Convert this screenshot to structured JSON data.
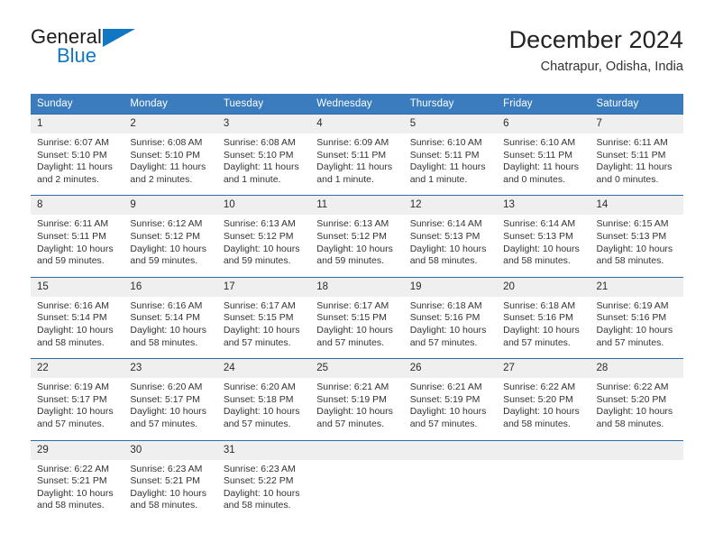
{
  "logo": {
    "text_primary": "General",
    "text_secondary": "Blue",
    "primary_color": "#1b1b1b",
    "accent_color": "#1277c2"
  },
  "header": {
    "title": "December 2024",
    "subtitle": "Chatrapur, Odisha, India"
  },
  "theme": {
    "header_row_bg": "#3a7cbe",
    "header_row_text": "#ffffff",
    "daynum_bg": "#efefef",
    "grid_line": "#2f6ca8",
    "body_text": "#333333"
  },
  "calendar": {
    "weekday_headers": [
      "Sunday",
      "Monday",
      "Tuesday",
      "Wednesday",
      "Thursday",
      "Friday",
      "Saturday"
    ],
    "weeks": [
      [
        {
          "day": "1",
          "sunrise": "Sunrise: 6:07 AM",
          "sunset": "Sunset: 5:10 PM",
          "daylight_line1": "Daylight: 11 hours",
          "daylight_line2": "and 2 minutes."
        },
        {
          "day": "2",
          "sunrise": "Sunrise: 6:08 AM",
          "sunset": "Sunset: 5:10 PM",
          "daylight_line1": "Daylight: 11 hours",
          "daylight_line2": "and 2 minutes."
        },
        {
          "day": "3",
          "sunrise": "Sunrise: 6:08 AM",
          "sunset": "Sunset: 5:10 PM",
          "daylight_line1": "Daylight: 11 hours",
          "daylight_line2": "and 1 minute."
        },
        {
          "day": "4",
          "sunrise": "Sunrise: 6:09 AM",
          "sunset": "Sunset: 5:11 PM",
          "daylight_line1": "Daylight: 11 hours",
          "daylight_line2": "and 1 minute."
        },
        {
          "day": "5",
          "sunrise": "Sunrise: 6:10 AM",
          "sunset": "Sunset: 5:11 PM",
          "daylight_line1": "Daylight: 11 hours",
          "daylight_line2": "and 1 minute."
        },
        {
          "day": "6",
          "sunrise": "Sunrise: 6:10 AM",
          "sunset": "Sunset: 5:11 PM",
          "daylight_line1": "Daylight: 11 hours",
          "daylight_line2": "and 0 minutes."
        },
        {
          "day": "7",
          "sunrise": "Sunrise: 6:11 AM",
          "sunset": "Sunset: 5:11 PM",
          "daylight_line1": "Daylight: 11 hours",
          "daylight_line2": "and 0 minutes."
        }
      ],
      [
        {
          "day": "8",
          "sunrise": "Sunrise: 6:11 AM",
          "sunset": "Sunset: 5:11 PM",
          "daylight_line1": "Daylight: 10 hours",
          "daylight_line2": "and 59 minutes."
        },
        {
          "day": "9",
          "sunrise": "Sunrise: 6:12 AM",
          "sunset": "Sunset: 5:12 PM",
          "daylight_line1": "Daylight: 10 hours",
          "daylight_line2": "and 59 minutes."
        },
        {
          "day": "10",
          "sunrise": "Sunrise: 6:13 AM",
          "sunset": "Sunset: 5:12 PM",
          "daylight_line1": "Daylight: 10 hours",
          "daylight_line2": "and 59 minutes."
        },
        {
          "day": "11",
          "sunrise": "Sunrise: 6:13 AM",
          "sunset": "Sunset: 5:12 PM",
          "daylight_line1": "Daylight: 10 hours",
          "daylight_line2": "and 59 minutes."
        },
        {
          "day": "12",
          "sunrise": "Sunrise: 6:14 AM",
          "sunset": "Sunset: 5:13 PM",
          "daylight_line1": "Daylight: 10 hours",
          "daylight_line2": "and 58 minutes."
        },
        {
          "day": "13",
          "sunrise": "Sunrise: 6:14 AM",
          "sunset": "Sunset: 5:13 PM",
          "daylight_line1": "Daylight: 10 hours",
          "daylight_line2": "and 58 minutes."
        },
        {
          "day": "14",
          "sunrise": "Sunrise: 6:15 AM",
          "sunset": "Sunset: 5:13 PM",
          "daylight_line1": "Daylight: 10 hours",
          "daylight_line2": "and 58 minutes."
        }
      ],
      [
        {
          "day": "15",
          "sunrise": "Sunrise: 6:16 AM",
          "sunset": "Sunset: 5:14 PM",
          "daylight_line1": "Daylight: 10 hours",
          "daylight_line2": "and 58 minutes."
        },
        {
          "day": "16",
          "sunrise": "Sunrise: 6:16 AM",
          "sunset": "Sunset: 5:14 PM",
          "daylight_line1": "Daylight: 10 hours",
          "daylight_line2": "and 58 minutes."
        },
        {
          "day": "17",
          "sunrise": "Sunrise: 6:17 AM",
          "sunset": "Sunset: 5:15 PM",
          "daylight_line1": "Daylight: 10 hours",
          "daylight_line2": "and 57 minutes."
        },
        {
          "day": "18",
          "sunrise": "Sunrise: 6:17 AM",
          "sunset": "Sunset: 5:15 PM",
          "daylight_line1": "Daylight: 10 hours",
          "daylight_line2": "and 57 minutes."
        },
        {
          "day": "19",
          "sunrise": "Sunrise: 6:18 AM",
          "sunset": "Sunset: 5:16 PM",
          "daylight_line1": "Daylight: 10 hours",
          "daylight_line2": "and 57 minutes."
        },
        {
          "day": "20",
          "sunrise": "Sunrise: 6:18 AM",
          "sunset": "Sunset: 5:16 PM",
          "daylight_line1": "Daylight: 10 hours",
          "daylight_line2": "and 57 minutes."
        },
        {
          "day": "21",
          "sunrise": "Sunrise: 6:19 AM",
          "sunset": "Sunset: 5:16 PM",
          "daylight_line1": "Daylight: 10 hours",
          "daylight_line2": "and 57 minutes."
        }
      ],
      [
        {
          "day": "22",
          "sunrise": "Sunrise: 6:19 AM",
          "sunset": "Sunset: 5:17 PM",
          "daylight_line1": "Daylight: 10 hours",
          "daylight_line2": "and 57 minutes."
        },
        {
          "day": "23",
          "sunrise": "Sunrise: 6:20 AM",
          "sunset": "Sunset: 5:17 PM",
          "daylight_line1": "Daylight: 10 hours",
          "daylight_line2": "and 57 minutes."
        },
        {
          "day": "24",
          "sunrise": "Sunrise: 6:20 AM",
          "sunset": "Sunset: 5:18 PM",
          "daylight_line1": "Daylight: 10 hours",
          "daylight_line2": "and 57 minutes."
        },
        {
          "day": "25",
          "sunrise": "Sunrise: 6:21 AM",
          "sunset": "Sunset: 5:19 PM",
          "daylight_line1": "Daylight: 10 hours",
          "daylight_line2": "and 57 minutes."
        },
        {
          "day": "26",
          "sunrise": "Sunrise: 6:21 AM",
          "sunset": "Sunset: 5:19 PM",
          "daylight_line1": "Daylight: 10 hours",
          "daylight_line2": "and 57 minutes."
        },
        {
          "day": "27",
          "sunrise": "Sunrise: 6:22 AM",
          "sunset": "Sunset: 5:20 PM",
          "daylight_line1": "Daylight: 10 hours",
          "daylight_line2": "and 58 minutes."
        },
        {
          "day": "28",
          "sunrise": "Sunrise: 6:22 AM",
          "sunset": "Sunset: 5:20 PM",
          "daylight_line1": "Daylight: 10 hours",
          "daylight_line2": "and 58 minutes."
        }
      ],
      [
        {
          "day": "29",
          "sunrise": "Sunrise: 6:22 AM",
          "sunset": "Sunset: 5:21 PM",
          "daylight_line1": "Daylight: 10 hours",
          "daylight_line2": "and 58 minutes."
        },
        {
          "day": "30",
          "sunrise": "Sunrise: 6:23 AM",
          "sunset": "Sunset: 5:21 PM",
          "daylight_line1": "Daylight: 10 hours",
          "daylight_line2": "and 58 minutes."
        },
        {
          "day": "31",
          "sunrise": "Sunrise: 6:23 AM",
          "sunset": "Sunset: 5:22 PM",
          "daylight_line1": "Daylight: 10 hours",
          "daylight_line2": "and 58 minutes."
        },
        {
          "day": "",
          "sunrise": "",
          "sunset": "",
          "daylight_line1": "",
          "daylight_line2": ""
        },
        {
          "day": "",
          "sunrise": "",
          "sunset": "",
          "daylight_line1": "",
          "daylight_line2": ""
        },
        {
          "day": "",
          "sunrise": "",
          "sunset": "",
          "daylight_line1": "",
          "daylight_line2": ""
        },
        {
          "day": "",
          "sunrise": "",
          "sunset": "",
          "daylight_line1": "",
          "daylight_line2": ""
        }
      ]
    ]
  }
}
